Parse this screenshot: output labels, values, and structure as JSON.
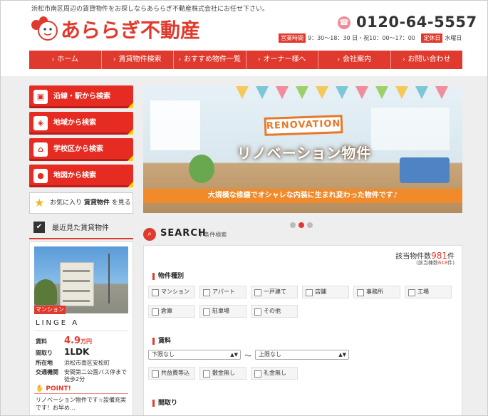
{
  "header": {
    "tagline": "浜松市南区周辺の賃貸物件をお探しならあららぎ不動産株式会社にお任せ下さい。",
    "logo_text": "あららぎ不動産",
    "phone": "0120-64-5557",
    "hours_label": "営業時間",
    "hours": "9：30～18：30 日・祝10：00～17：00",
    "holiday_label": "定休日",
    "holiday": "水曜日"
  },
  "nav": {
    "items": [
      {
        "label": "ホーム"
      },
      {
        "label": "賃貸物件検索"
      },
      {
        "label": "おすすめ物件一覧"
      },
      {
        "label": "オーナー様へ"
      },
      {
        "label": "会社案内"
      },
      {
        "label": "お問い合わせ"
      }
    ]
  },
  "sidebar": {
    "buttons": [
      {
        "label": "沿線・駅から検索",
        "icon": "train-icon"
      },
      {
        "label": "地域から検索",
        "icon": "map-region-icon"
      },
      {
        "label": "学校区から検索",
        "icon": "school-icon"
      },
      {
        "label": "地図から検索",
        "icon": "map-pin-icon"
      }
    ],
    "favorites": {
      "pre": "お気に入り",
      "bold": "賃貸物件",
      "post": "を見る"
    },
    "recent_title": "最近見た賃貸物件"
  },
  "property": {
    "type": "マンション",
    "name": "LINGE A",
    "rent_label": "賃料",
    "rent_value": "4.9",
    "rent_unit": "万円",
    "layout_label": "間取り",
    "layout_value": "1LDK",
    "address_label": "所在地",
    "address_value": "浜松市南区安松町",
    "transit_label": "交通機関",
    "transit_value": "安間第二公園バス停まで徒歩2分",
    "point_label": "POINT!",
    "point_text": "リノベーション物件です☆設備充実です！お早め..."
  },
  "banner": {
    "badge": "RENOVATION",
    "title": "リノベーション物件",
    "subtitle": "大規模な修繕でオシャレな内装に生まれ変わった物件です♪",
    "active_slide": 2,
    "slide_count": 3
  },
  "search": {
    "title": "SEARCH",
    "subtitle": "/ 条件検索",
    "count_label": "該当物件数",
    "count_value": "981",
    "count_unit": "件",
    "count2_label": "(該当棟数",
    "count2_value": "618",
    "count2_unit": "件)",
    "type_section": "物件種別",
    "type_options": [
      "マンション",
      "アパート",
      "一戸建て",
      "店舗",
      "事務所",
      "工場",
      "倉庫",
      "駐車場",
      "その他"
    ],
    "rent_section": "賃料",
    "rent_min": "下限なし",
    "rent_tilde": "〜",
    "rent_max": "上限なし",
    "rent_options": [
      "共益費等込",
      "敷金無し",
      "礼金無し"
    ],
    "layout_section": "間取り"
  },
  "colors": {
    "accent": "#e03a2e",
    "banner_band": "#f08a2a",
    "corner": "#ffd200"
  }
}
